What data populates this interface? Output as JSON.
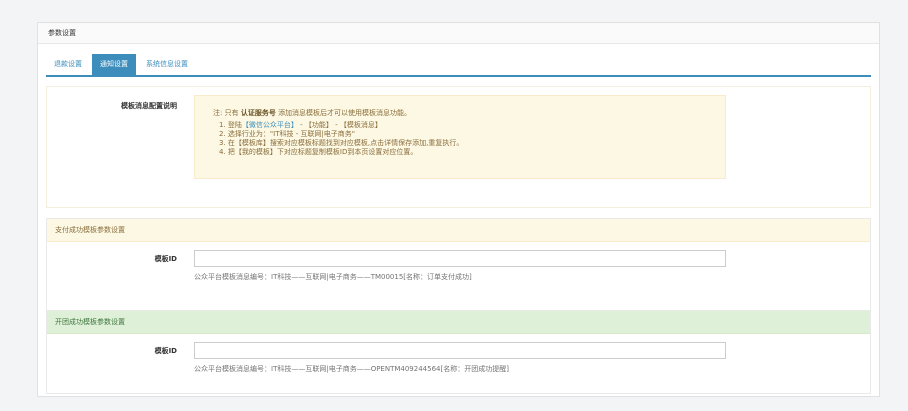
{
  "panel": {
    "title": "参数设置"
  },
  "tabs": [
    {
      "label": "退款设置",
      "active": false
    },
    {
      "label": "通知设置",
      "active": true
    },
    {
      "label": "系统信息设置",
      "active": false
    }
  ],
  "config": {
    "label": "模板消息配置说明",
    "note_prefix": "注: 只有",
    "note_bold": "认证服务号",
    "note_suffix": "添加消息模板后才可以使用模板消息功能。",
    "steps": {
      "s1_a": "1. 登陆",
      "s1_b": "【微信公众平台】",
      "s1_c": " - 【功能】 - 【模板消息】",
      "s2": "2. 选择行业为：\"IT科技 - 互联网|电子商务\"",
      "s3": "3. 在【模板库】搜索对应模板标题找到对应模板,点击详情保存添加,重复执行。",
      "s4": "4. 把【我的模板】下对应标题复制模板ID到本页设置对应位置。"
    }
  },
  "pay_section": {
    "title": "支付成功模板参数设置",
    "label": "模板ID",
    "value": "",
    "help": "公众平台模板消息编号：IT科技——互联网|电子商务——TM00015[名称：订单支付成功]"
  },
  "group_section": {
    "title": "开团成功模板参数设置",
    "label": "模板ID",
    "value": "",
    "help": "公众平台模板消息编号：IT科技——互联网|电子商务——OPENTM409244564[名称：开团成功提醒]"
  }
}
